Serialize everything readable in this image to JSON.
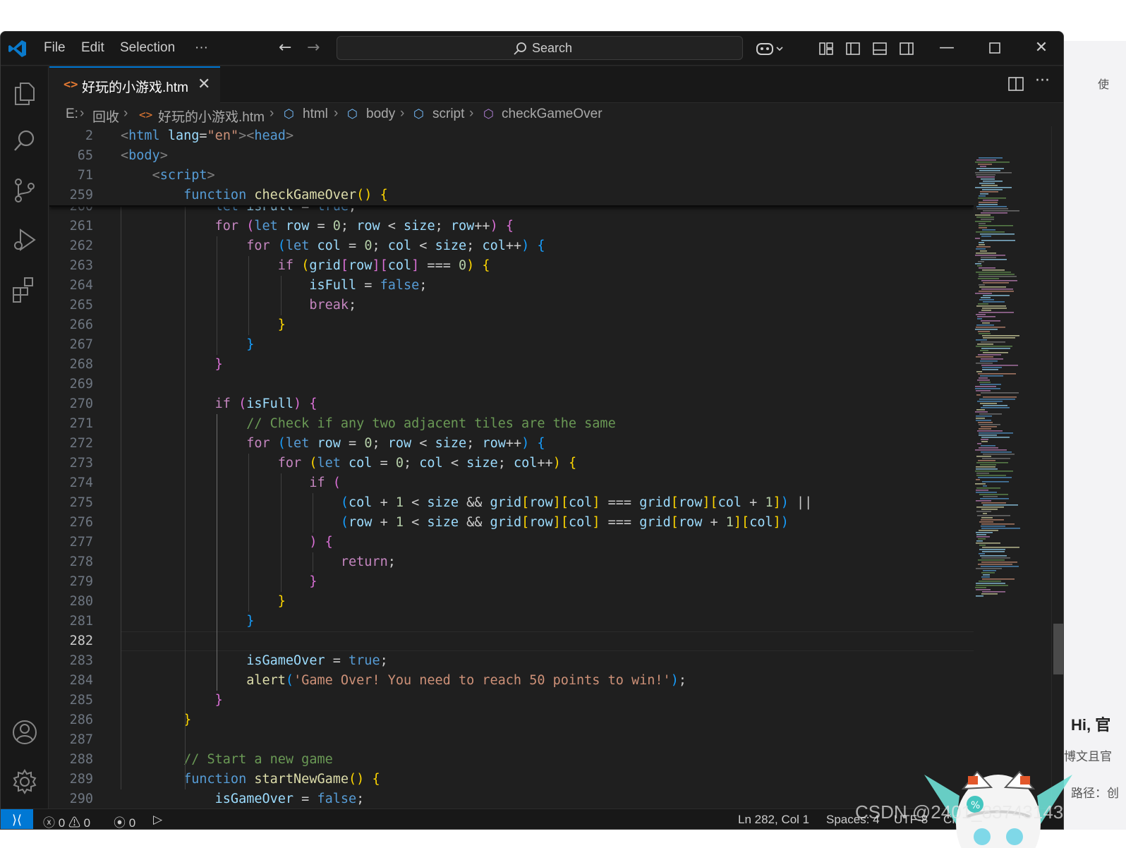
{
  "window": {
    "menu": [
      "File",
      "Edit",
      "Selection",
      "···"
    ],
    "search_placeholder": "Search"
  },
  "tab": {
    "filename": "好玩的小游戏.htm"
  },
  "breadcrumb": [
    "E:",
    "回收",
    "好玩的小游戏.htm",
    "html",
    "body",
    "script",
    "checkGameOver"
  ],
  "sticky_lines": [
    {
      "n": "2",
      "text": "<html lang=\"en\"><head>"
    },
    {
      "n": "65",
      "text": "<body>"
    },
    {
      "n": "71",
      "text": "    <script>"
    },
    {
      "n": "259",
      "text": "        function checkGameOver() {"
    }
  ],
  "code_lines": [
    {
      "n": "260",
      "text": "            let isFull = true;"
    },
    {
      "n": "261",
      "text": "            for (let row = 0; row < size; row++) {"
    },
    {
      "n": "262",
      "text": "                for (let col = 0; col < size; col++) {"
    },
    {
      "n": "263",
      "text": "                    if (grid[row][col] === 0) {"
    },
    {
      "n": "264",
      "text": "                        isFull = false;"
    },
    {
      "n": "265",
      "text": "                        break;"
    },
    {
      "n": "266",
      "text": "                    }"
    },
    {
      "n": "267",
      "text": "                }"
    },
    {
      "n": "268",
      "text": "            }"
    },
    {
      "n": "269",
      "text": ""
    },
    {
      "n": "270",
      "text": "            if (isFull) {"
    },
    {
      "n": "271",
      "text": "                // Check if any two adjacent tiles are the same"
    },
    {
      "n": "272",
      "text": "                for (let row = 0; row < size; row++) {"
    },
    {
      "n": "273",
      "text": "                    for (let col = 0; col < size; col++) {"
    },
    {
      "n": "274",
      "text": "                        if ("
    },
    {
      "n": "275",
      "text": "                            (col + 1 < size && grid[row][col] === grid[row][col + 1]) ||"
    },
    {
      "n": "276",
      "text": "                            (row + 1 < size && grid[row][col] === grid[row + 1][col])"
    },
    {
      "n": "277",
      "text": "                        ) {"
    },
    {
      "n": "278",
      "text": "                            return;"
    },
    {
      "n": "279",
      "text": "                        }"
    },
    {
      "n": "280",
      "text": "                    }"
    },
    {
      "n": "281",
      "text": "                }"
    },
    {
      "n": "282",
      "text": ""
    },
    {
      "n": "283",
      "text": "                isGameOver = true;"
    },
    {
      "n": "284",
      "text": "                alert('Game Over! You need to reach 50 points to win!');"
    },
    {
      "n": "285",
      "text": "            }"
    },
    {
      "n": "286",
      "text": "        }"
    },
    {
      "n": "287",
      "text": ""
    },
    {
      "n": "288",
      "text": "        // Start a new game"
    },
    {
      "n": "289",
      "text": "        function startNewGame() {"
    },
    {
      "n": "290",
      "text": "            isGameOver = false;"
    }
  ],
  "active_line": "282",
  "status": {
    "errors": "0",
    "warnings": "0",
    "ports": "0",
    "cursor": "Ln 282, Col 1",
    "spaces": "Spaces: 4",
    "encoding": "UTF-8",
    "eol": "CR"
  },
  "background_page": {
    "greeting": "Hi, 官",
    "line1": "博文且官",
    "line2": "路径：创",
    "corner": "使"
  },
  "watermark": "CSDN @2401_83743143",
  "colors": {
    "accent": "#0078d4",
    "editor_bg": "#1f1f1f",
    "titlebar_bg": "#181818"
  }
}
